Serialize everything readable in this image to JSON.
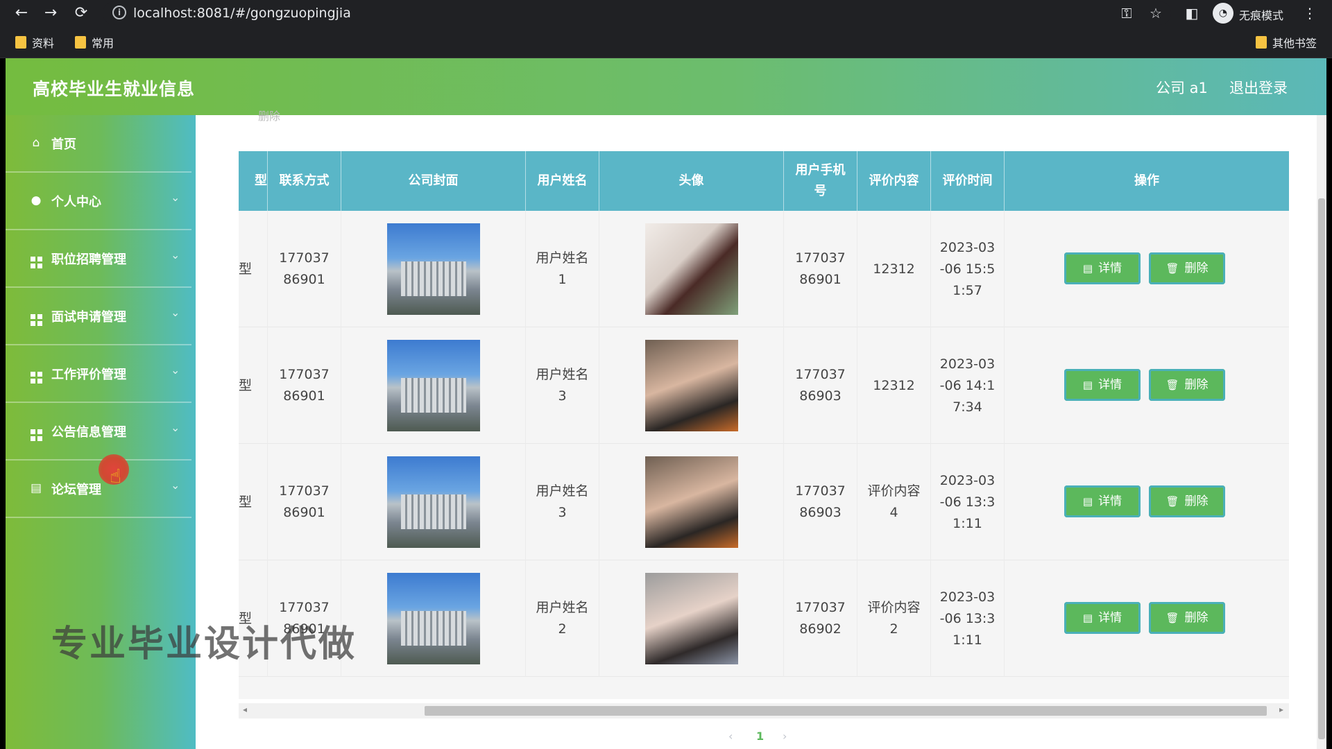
{
  "browser": {
    "back_glyph": "←",
    "forward_glyph": "→",
    "reload_glyph": "⟳",
    "info_glyph": "i",
    "url": "localhost:8081/#/gongzuopingjia",
    "key_glyph": "⚿",
    "star_glyph": "☆",
    "split_glyph": "◧",
    "avatar_glyph": "◔",
    "incognito_label": "无痕模式",
    "menu_glyph": "⋮",
    "bookmarks": [
      {
        "label": "资料"
      },
      {
        "label": "常用"
      }
    ],
    "other_bookmarks": "其他书签"
  },
  "header": {
    "title": "高校毕业生就业信息",
    "user": "公司 a1",
    "logout": "退出登录"
  },
  "sidebar": {
    "items": [
      {
        "label": "首页",
        "icon": "home-icon",
        "glyph": "⌂",
        "chevron": ""
      },
      {
        "label": "个人中心",
        "icon": "user-icon",
        "glyph": "●",
        "chevron": "⌄"
      },
      {
        "label": "职位招聘管理",
        "icon": "grid-icon",
        "glyph": "",
        "chevron": "⌄"
      },
      {
        "label": "面试申请管理",
        "icon": "grid-icon",
        "glyph": "",
        "chevron": "⌄"
      },
      {
        "label": "工作评价管理",
        "icon": "grid-icon",
        "glyph": "",
        "chevron": "⌄"
      },
      {
        "label": "公告信息管理",
        "icon": "grid-icon",
        "glyph": "",
        "chevron": "⌄"
      },
      {
        "label": "论坛管理",
        "icon": "clipboard-icon",
        "glyph": "▤",
        "chevron": "⌄"
      }
    ]
  },
  "watermark": "专业毕业设计代做",
  "cursor_glyph": "☝",
  "content": {
    "toolbar_ghost_label": "删除",
    "table": {
      "headers": [
        "型",
        "联系方式",
        "公司封面",
        "用户姓名",
        "头像",
        "用户手机号",
        "评价内容",
        "评价时间",
        "操作"
      ],
      "rows": [
        {
          "type": "型",
          "contact": "17703786901",
          "user_name": "用户姓名1",
          "phone": "17703786901",
          "content": "12312",
          "time": "2023-03-06 15:51:57",
          "avatar": "woman-illustration"
        },
        {
          "type": "型",
          "contact": "17703786901",
          "user_name": "用户姓名3",
          "phone": "17703786903",
          "content": "12312",
          "time": "2023-03-06 14:17:34",
          "avatar": "woman-photo"
        },
        {
          "type": "型",
          "contact": "17703786901",
          "user_name": "用户姓名3",
          "phone": "17703786903",
          "content": "评价内容4",
          "time": "2023-03-06 13:31:11",
          "avatar": "woman-photo"
        },
        {
          "type": "型",
          "contact": "17703786901",
          "user_name": "用户姓名2",
          "phone": "17703786902",
          "content": "评价内容2",
          "time": "2023-03-06 13:31:11",
          "avatar": "woman-photo-2"
        }
      ],
      "detail_label": "详情",
      "delete_label": "删除",
      "detail_glyph": "▤",
      "delete_glyph": "🗑"
    },
    "pagination": {
      "prev": "‹",
      "current": "1",
      "next": "›"
    },
    "scroll_left": "◂",
    "scroll_right": "▸"
  }
}
